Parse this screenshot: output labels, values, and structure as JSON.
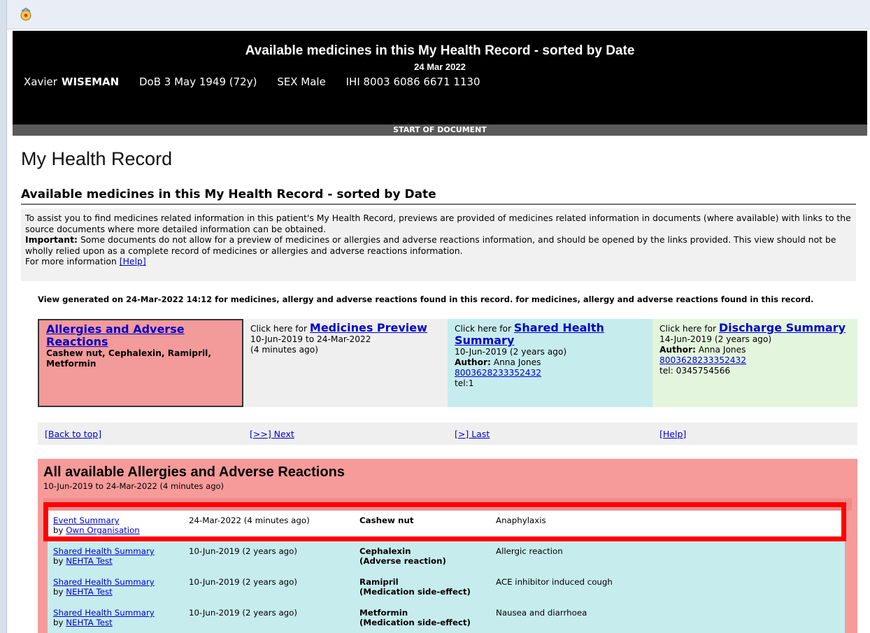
{
  "header": {
    "title": "Available medicines in this My Health Record - sorted by Date",
    "date": "24 Mar 2022",
    "patient_first": "Xavier",
    "patient_last": "WISEMAN",
    "dob": "DoB 3 May 1949 (72y)",
    "sex": "SEX Male",
    "ihi": "IHI 8003 6086 6671 1130"
  },
  "start_label": "START OF DOCUMENT",
  "page_title": "My Health Record",
  "section_heading": "Available medicines in this My Health Record - sorted by Date",
  "intro": {
    "line1": "To assist you to find medicines related information in this patient's My Health Record, previews are provided of medicines related information in documents (where available) with links to the source documents where more detailed information can be obtained.",
    "important_label": "Important:",
    "line2": " Some documents do not allow for a preview of medicines or allergies and adverse reactions information, and should be opened by the links provided. This view should not be wholly relied upon as a complete record of medicines or allergies and adverse reactions information.",
    "more_info": "For more information ",
    "help_link": "[Help]"
  },
  "view_generated": "View generated on 24-Mar-2022 14:12 for medicines, allergy and adverse reactions found in this record. for medicines, allergy and adverse reactions found in this record.",
  "cards": {
    "allergies": {
      "link": "Allergies and Adverse Reactions",
      "items": "Cashew nut, Cephalexin, Ramipril, Metformin"
    },
    "medicines": {
      "prefix": "Click here for ",
      "link": "Medicines Preview",
      "range": "10-Jun-2019 to 24-Mar-2022",
      "ago": "(4 minutes ago)"
    },
    "shs": {
      "prefix": "Click here for ",
      "link": "Shared Health Summary",
      "date": "10-Jun-2019 (2 years ago)",
      "author_label": "Author:",
      "author": " Anna Jones",
      "id": "8003628233352432",
      "tel": "tel:1"
    },
    "discharge": {
      "prefix": "Click here for ",
      "link": "Discharge Summary",
      "date": "14-Jun-2019 (2 years ago)",
      "author_label": "Author:",
      "author": " Anna Jones",
      "id": "8003628233352432",
      "tel": "tel: 0345754566"
    }
  },
  "nav": {
    "back": "[Back to top]",
    "next": "[>>] Next",
    "last": "[>] Last",
    "help": "[Help]"
  },
  "allergy_section": {
    "heading": "All available Allergies and Adverse Reactions",
    "subheading": "10-Jun-2019 to 24-Mar-2022 (4 minutes ago)",
    "rows": [
      {
        "doc": "Event Summary",
        "by": "by ",
        "org": "Own Organisation",
        "date": "24-Mar-2022 (4 minutes ago)",
        "substance": "Cashew nut",
        "substance2": "",
        "manifestation": "Anaphylaxis"
      },
      {
        "doc": "Shared Health Summary",
        "by": "by ",
        "org": "NEHTA Test",
        "date": "10-Jun-2019 (2 years ago)",
        "substance": "Cephalexin",
        "substance2": "(Adverse reaction)",
        "manifestation": "Allergic reaction"
      },
      {
        "doc": "Shared Health Summary",
        "by": "by ",
        "org": "NEHTA Test",
        "date": "10-Jun-2019 (2 years ago)",
        "substance": "Ramipril",
        "substance2": "(Medication side-effect)",
        "manifestation": "ACE inhibitor induced cough"
      },
      {
        "doc": "Shared Health Summary",
        "by": "by ",
        "org": "NEHTA Test",
        "date": "10-Jun-2019 (2 years ago)",
        "substance": "Metformin",
        "substance2": "(Medication side-effect)",
        "manifestation": "Nausea and diarrhoea"
      }
    ]
  },
  "colors": {
    "allergy_red": "#f39a9a",
    "shs_cyan": "#c7ecee",
    "discharge_green": "#e3f5dd",
    "highlight_red": "#ff0000",
    "link_blue": "#0000cc"
  }
}
